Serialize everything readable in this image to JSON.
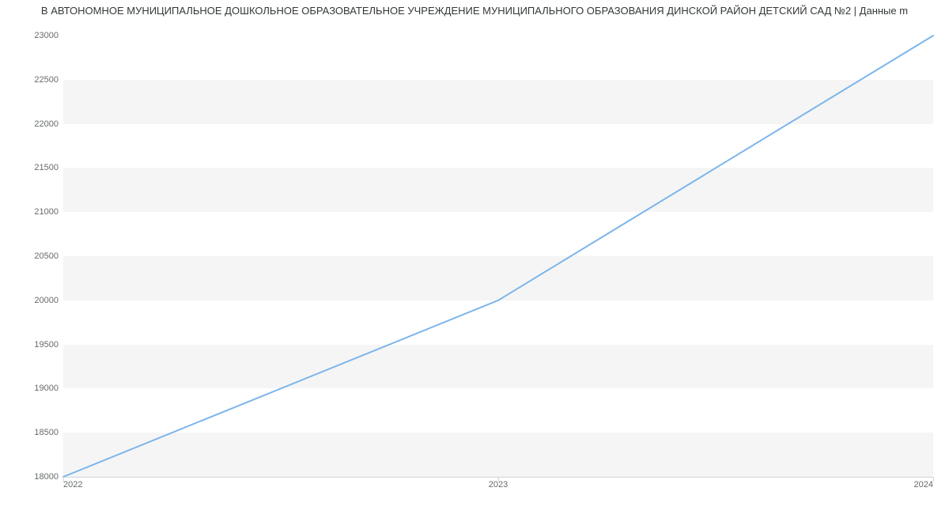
{
  "chart_data": {
    "type": "line",
    "title": "В АВТОНОМНОЕ МУНИЦИПАЛЬНОЕ ДОШКОЛЬНОЕ ОБРАЗОВАТЕЛЬНОЕ УЧРЕЖДЕНИЕ МУНИЦИПАЛЬНОГО ОБРАЗОВАНИЯ ДИНСКОЙ РАЙОН ДЕТСКИЙ САД №2 | Данные m",
    "x": [
      2022,
      2023,
      2024
    ],
    "series": [
      {
        "name": "series1",
        "values": [
          18000,
          20000,
          23000
        ]
      }
    ],
    "xlabel": "",
    "ylabel": "",
    "xlim": [
      2022,
      2024
    ],
    "ylim": [
      18000,
      23000
    ],
    "x_ticks": [
      2022,
      2023,
      2024
    ],
    "y_ticks": [
      18000,
      18500,
      19000,
      19500,
      20000,
      20500,
      21000,
      21500,
      22000,
      22500,
      23000
    ],
    "line_color": "#7cb5ec"
  }
}
